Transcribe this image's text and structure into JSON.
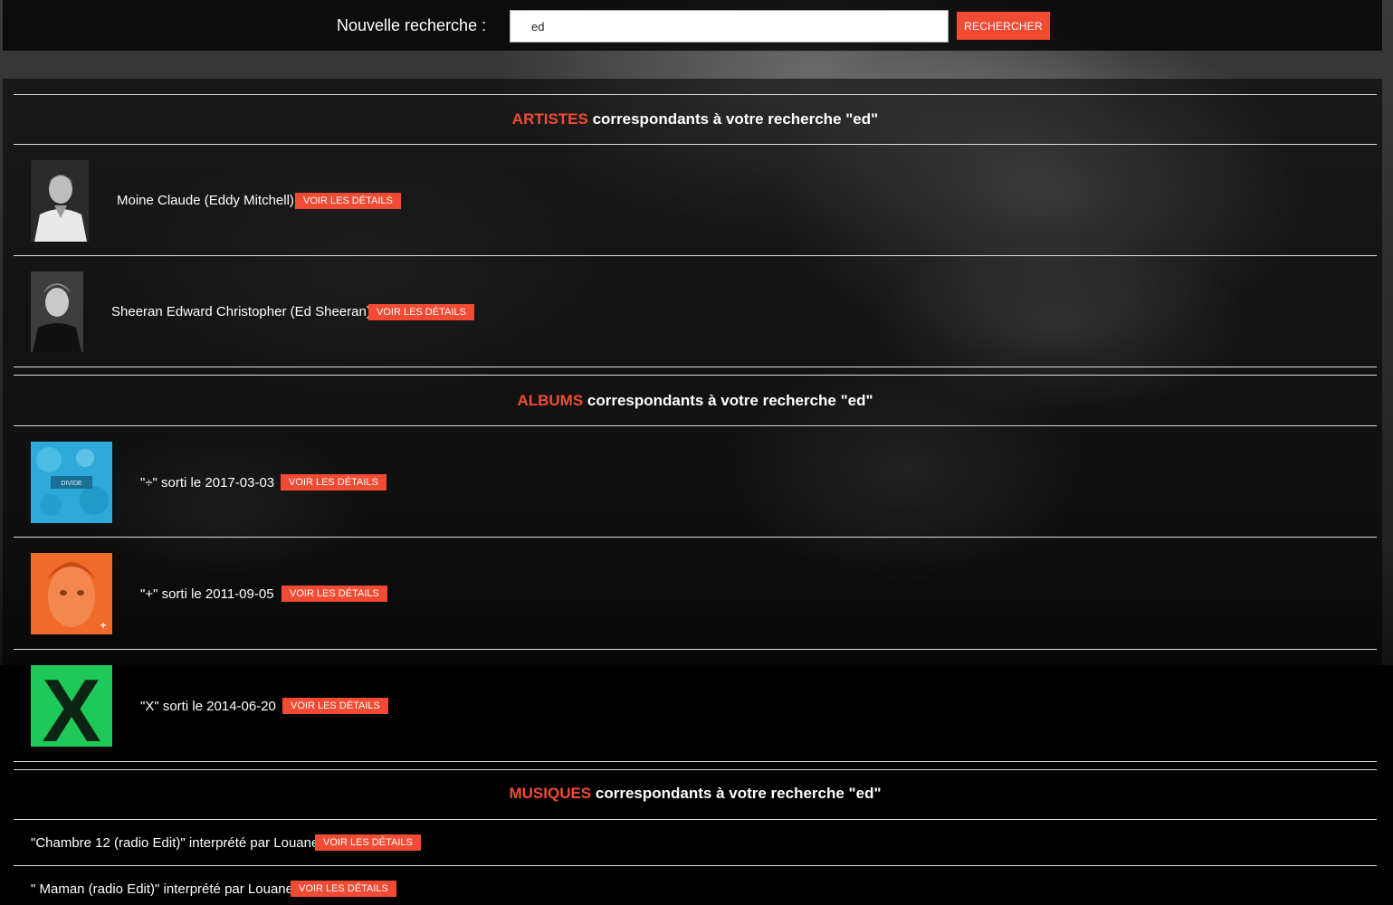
{
  "search": {
    "label": "Nouvelle recherche :",
    "value": "ed",
    "button_label": "RECHERCHER"
  },
  "colors": {
    "accent": "#f24b34",
    "divide_cover": "#2fa9d9",
    "plus_cover": "#f06a2a",
    "x_cover": "#1ec95a"
  },
  "sections": {
    "artists": {
      "keyword": "ARTISTES",
      "rest": " correspondants à votre recherche \"ed\""
    },
    "albums": {
      "keyword": "ALBUMS",
      "rest": " correspondants à votre recherche \"ed\""
    },
    "musiques": {
      "keyword": "MUSIQUES",
      "rest": " correspondants à votre recherche \"ed\""
    }
  },
  "artists": [
    {
      "name": "Moine Claude (Eddy Mitchell)",
      "button": "VOIR LES DÉTAILS"
    },
    {
      "name": "Sheeran Edward Christopher (Ed Sheeran)",
      "button": "VOIR LES DÉTAILS"
    }
  ],
  "albums": [
    {
      "text": "\"÷\" sorti le 2017-03-03",
      "cover_label": "DIVIDE",
      "button": "VOIR LES DÉTAILS"
    },
    {
      "text": "\"+\" sorti le 2011-09-05",
      "cover_label": "+",
      "button": "VOIR LES DÉTAILS"
    },
    {
      "text": "\"X\" sorti le 2014-06-20",
      "cover_label": "X",
      "button": "VOIR LES DÉTAILS"
    }
  ],
  "songs": [
    {
      "text": "\"Chambre 12 (radio Edit)\" interprété par Louane",
      "button": "VOIR LES DÉTAILS"
    },
    {
      "text": "\" Maman (radio Edit)\" interprété par Louane",
      "button": "VOIR LES DÉTAILS"
    }
  ]
}
